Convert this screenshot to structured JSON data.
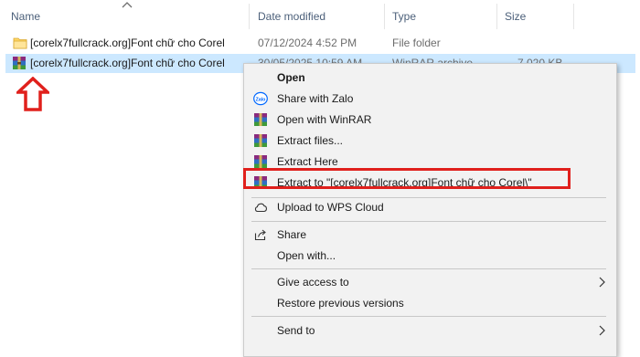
{
  "columns": {
    "name": "Name",
    "date_modified": "Date modified",
    "type": "Type",
    "size": "Size"
  },
  "files": [
    {
      "name": "[corelx7fullcrack.org]Font chữ cho Corel",
      "date": "07/12/2024 4:52 PM",
      "type": "File folder",
      "size": "",
      "icon": "folder-icon"
    },
    {
      "name": "[corelx7fullcrack.org]Font chữ cho Corel",
      "date": "30/05/2025 10:59 AM",
      "type": "WinRAR archive",
      "size": "7,020 KB",
      "icon": "winrar-archive-icon",
      "selected": true
    }
  ],
  "context_menu": {
    "open": "Open",
    "share_zalo": "Share with Zalo",
    "zalo_icon_text": "Zalo",
    "open_winrar": "Open with WinRAR",
    "extract_files": "Extract files...",
    "extract_here": "Extract Here",
    "extract_to": "Extract to \"[corelx7fullcrack.org]Font chữ cho Corel\\\"",
    "upload_wps": "Upload to WPS Cloud",
    "share": "Share",
    "open_with": "Open with...",
    "give_access": "Give access to",
    "restore_versions": "Restore previous versions",
    "send_to": "Send to"
  },
  "colors": {
    "selection": "#cce8ff",
    "annotation_red": "#e0201c",
    "menu_bg": "#f2f2f2"
  }
}
